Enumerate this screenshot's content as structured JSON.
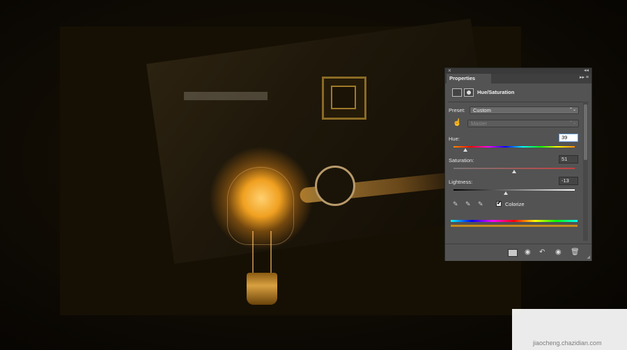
{
  "panel": {
    "tab_label": "Properties",
    "adjustment_title": "Hue/Saturation",
    "preset_label": "Preset:",
    "preset_value": "Custom",
    "channel_value": "Master",
    "hue_label": "Hue:",
    "hue_value": "39",
    "hue_position": 0.1,
    "saturation_label": "Saturation:",
    "saturation_value": "51",
    "saturation_position": 0.5,
    "lightness_label": "Lightness:",
    "lightness_value": "-13",
    "lightness_position": 0.43,
    "colorize_label": "Colorize",
    "colorize_checked": true,
    "close_glyph": "×",
    "collapse_glyph": "◂◂",
    "menu_glyph": "▸▸ ≡",
    "dropdown_arrow": "⌃⌄",
    "hand_glyph": "☝",
    "eyedropper_glyph": "✎",
    "footer": {
      "prev_glyph": "◉",
      "reset_glyph": "↶",
      "eye_glyph": "◉",
      "trash_glyph": "🗑"
    }
  },
  "colors": {
    "panel_bg": "#535353",
    "colorize_bar": "#c88a1a"
  },
  "canvas_stamp": "",
  "watermark": {
    "main": "",
    "sub": "jiaocheng.chazidian.com"
  }
}
